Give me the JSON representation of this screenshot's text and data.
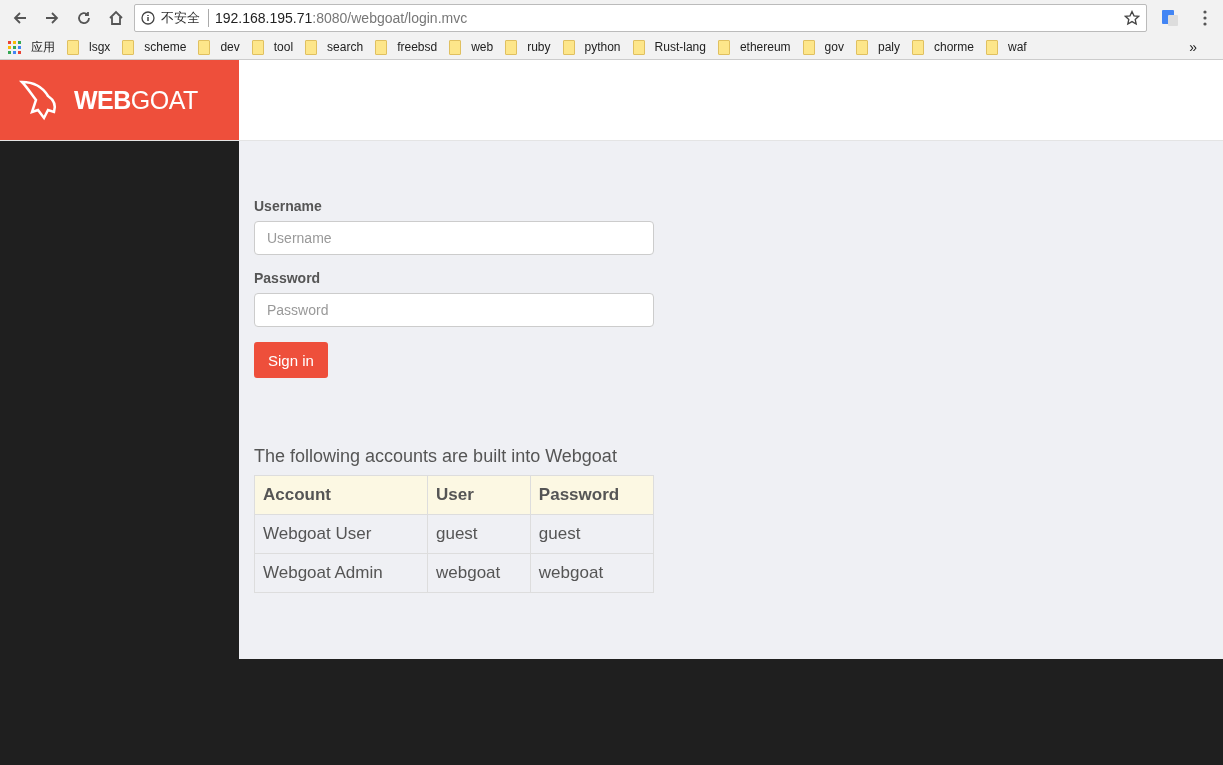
{
  "browser": {
    "security_label": "不安全",
    "url_host": "192.168.195.71",
    "url_path": ":8080/webgoat/login.mvc"
  },
  "bookmarks": {
    "apps_label": "应用",
    "items": [
      "lsgx",
      "scheme",
      "dev",
      "tool",
      "search",
      "freebsd",
      "web",
      "ruby",
      "python",
      "Rust-lang",
      "ethereum",
      "gov",
      "paly",
      "chorme",
      "waf"
    ],
    "more": "»"
  },
  "header": {
    "logo": "**WEB**GOAT"
  },
  "login": {
    "username_label": "Username",
    "username_placeholder": "Username",
    "password_label": "Password",
    "password_placeholder": "Password",
    "submit": "Sign in"
  },
  "accounts": {
    "intro": "The following accounts are built into Webgoat",
    "columns": [
      "Account",
      "User",
      "Password"
    ],
    "rows": [
      [
        "Webgoat User",
        "guest",
        "guest"
      ],
      [
        "Webgoat Admin",
        "webgoat",
        "webgoat"
      ]
    ]
  }
}
